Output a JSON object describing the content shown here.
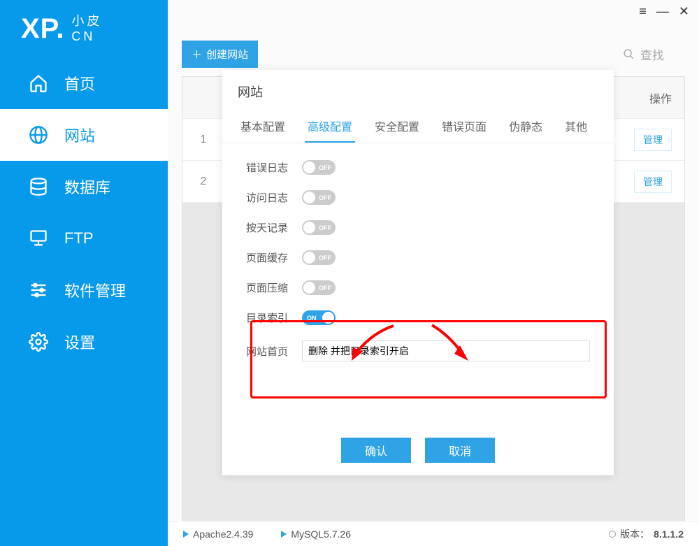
{
  "logo": {
    "main": "XP",
    "sub_top": "小皮",
    "sub_bottom": "CN"
  },
  "nav": [
    {
      "label": "首页",
      "icon": "home"
    },
    {
      "label": "网站",
      "icon": "globe",
      "active": true
    },
    {
      "label": "数据库",
      "icon": "database"
    },
    {
      "label": "FTP",
      "icon": "ftp"
    },
    {
      "label": "软件管理",
      "icon": "sliders"
    },
    {
      "label": "设置",
      "icon": "gear"
    }
  ],
  "toolbar": {
    "create_label": "创建网站",
    "search_placeholder": "查找"
  },
  "table": {
    "action_header": "操作",
    "rows": [
      {
        "num": "1",
        "manage": "管理"
      },
      {
        "num": "2",
        "manage": "管理"
      }
    ]
  },
  "modal": {
    "title": "网站",
    "tabs": [
      "基本配置",
      "高级配置",
      "安全配置",
      "错误页面",
      "伪静态",
      "其他"
    ],
    "active_tab": 1,
    "settings": [
      {
        "label": "错误日志",
        "state": "off",
        "text": "OFF"
      },
      {
        "label": "访问日志",
        "state": "off",
        "text": "OFF"
      },
      {
        "label": "按天记录",
        "state": "off",
        "text": "OFF"
      },
      {
        "label": "页面缓存",
        "state": "off",
        "text": "OFF"
      },
      {
        "label": "页面压缩",
        "state": "off",
        "text": "OFF"
      },
      {
        "label": "目录索引",
        "state": "on",
        "text": "ON"
      }
    ],
    "homepage": {
      "label": "网站首页",
      "value": "删除 并把目录索引开启"
    },
    "confirm": "确认",
    "cancel": "取消"
  },
  "statusbar": {
    "apache": "Apache2.4.39",
    "mysql": "MySQL5.7.26",
    "version_label": "版本：",
    "version": "8.1.1.2"
  }
}
